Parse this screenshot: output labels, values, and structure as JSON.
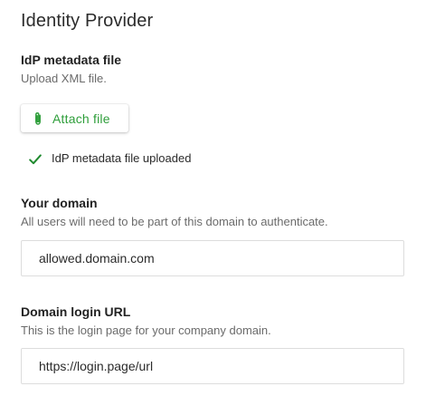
{
  "section": {
    "title": "Identity Provider"
  },
  "idp_metadata": {
    "label": "IdP metadata file",
    "help": "Upload XML file.",
    "attach_button_label": "Attach file",
    "status_text": "IdP metadata file uploaded",
    "status_icon": "checkmark-icon",
    "attach_icon": "paperclip-icon"
  },
  "domain": {
    "label": "Your domain",
    "help": "All users will need to be part of this domain to authenticate.",
    "value": "allowed.domain.com"
  },
  "login_url": {
    "label": "Domain login URL",
    "help": "This is the login page for your company domain.",
    "value": "https://login.page/url"
  },
  "colors": {
    "accent_green": "#2e9e3a",
    "check_green": "#1f8a2f"
  }
}
